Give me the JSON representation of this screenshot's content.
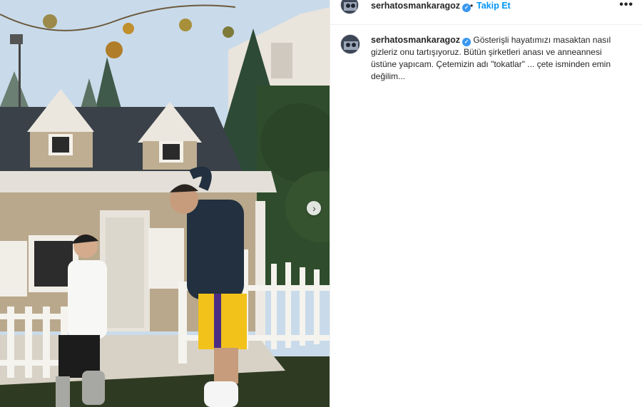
{
  "post": {
    "username": "serhatosmankaragoz",
    "verified_icon": "verified-badge-icon",
    "separator": "•",
    "follow_label": "Takip Et",
    "more_icon": "more-options-icon",
    "more_label": "•••",
    "carousel_icon": "chevron-right-icon",
    "carousel_glyph": "›",
    "caption": "Gösterişli hayatımızı masaktan nasıl gizleriz onu tartışıyoruz. Bütün şirketleri anası ve anneannesi üstüne yapıcam. Çetemizin adı \"tokatlar\" ... çete isminden emin değilim...",
    "accent_color": "#0095f6"
  }
}
